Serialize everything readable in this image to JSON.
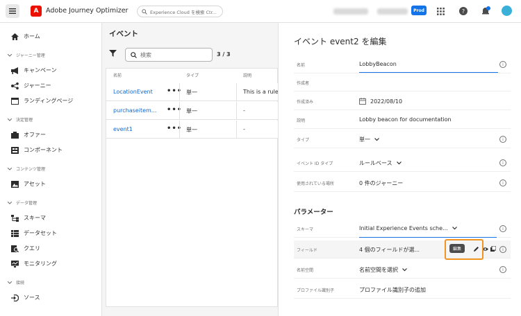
{
  "header": {
    "app_title": "Adobe Journey Optimizer",
    "logo_letter": "A",
    "search_placeholder": "Experience Cloud を検索 Ctr...",
    "prod_label": "Prod"
  },
  "sidebar": {
    "home": "ホーム",
    "sections": [
      {
        "label": "ジャーニー管理",
        "items": [
          "キャンペーン",
          "ジャーニー",
          "ランディングページ"
        ]
      },
      {
        "label": "決定管理",
        "items": [
          "オファー",
          "コンポーネント"
        ]
      },
      {
        "label": "コンテンツ管理",
        "items": [
          "アセット"
        ]
      },
      {
        "label": "データ管理",
        "items": [
          "スキーマ",
          "データセット",
          "クエリ",
          "モニタリング"
        ]
      },
      {
        "label": "接続",
        "items": [
          "ソース"
        ]
      }
    ]
  },
  "list": {
    "title": "イベント",
    "search_placeholder": "検索",
    "count": "3 / 3",
    "columns": [
      "名前",
      "タイプ",
      "説明"
    ],
    "rows": [
      {
        "name": "LocationEvent",
        "more": "•••",
        "type": "単一",
        "desc": "This is a rule-b"
      },
      {
        "name": "purchaseitem...",
        "more": "•••",
        "type": "単一",
        "desc": "-"
      },
      {
        "name": "event1",
        "more": "•••",
        "type": "単一",
        "desc": "-"
      }
    ]
  },
  "panel": {
    "title": "イベント event2 を編集",
    "fields": [
      {
        "label": "名前",
        "value": "LobbyBeacon"
      },
      {
        "label": "作成者",
        "value": ""
      },
      {
        "label": "作成済み",
        "value": "2022/08/10"
      },
      {
        "label": "説明",
        "value": "Lobby beacon for documentation"
      },
      {
        "label": "タイプ",
        "value": "単一"
      },
      {
        "label": "イベント ID タイプ",
        "value": "ルールベース"
      },
      {
        "label": "使用されている場所",
        "value": "0 件のジャーニー"
      }
    ],
    "params_title": "パラメーター",
    "params": [
      {
        "label": "スキーマ",
        "value": "Initial Experience Events sche..."
      },
      {
        "label": "フィールド",
        "value": "4 個のフィールドが選..."
      },
      {
        "label": "名前空間",
        "value": "名前空間を選択"
      },
      {
        "label": "プロファイル識別子",
        "value": "プロファイル識別子の追加"
      }
    ],
    "tooltip": "編集",
    "info_glyph": "i"
  },
  "colors": {
    "accent": "#1473e6",
    "brand": "#eb1000",
    "highlight": "#f29423",
    "link": "#0d66d0"
  }
}
